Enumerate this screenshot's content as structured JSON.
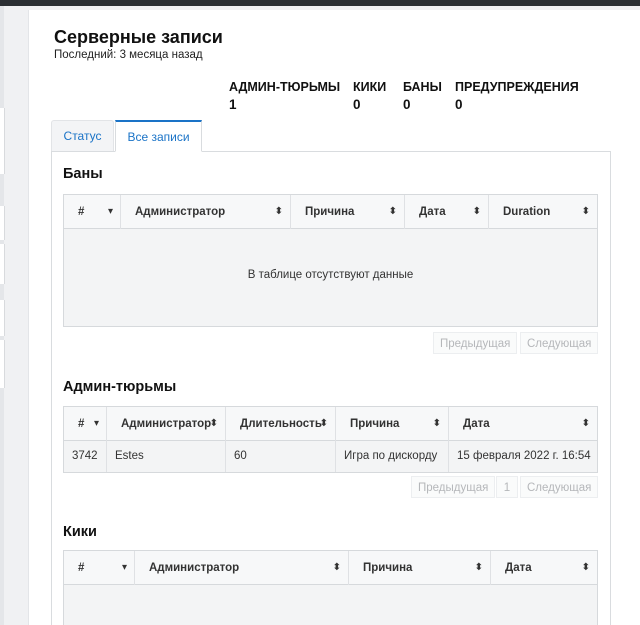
{
  "header": {
    "title": "Серверные записи",
    "last_seen": "Последний: 3 месяца назад"
  },
  "stats": [
    {
      "label": "АДМИН-ТЮРЬМЫ",
      "value": "1"
    },
    {
      "label": "КИКИ",
      "value": "0"
    },
    {
      "label": "БАНЫ",
      "value": "0"
    },
    {
      "label": "ПРЕДУПРЕЖДЕНИЯ",
      "value": "0"
    }
  ],
  "tabs": [
    {
      "label": "Статус",
      "active": false
    },
    {
      "label": "Все записи",
      "active": true
    }
  ],
  "bans": {
    "title": "Баны",
    "columns": [
      "#",
      "Администратор",
      "Причина",
      "Дата",
      "Duration"
    ],
    "empty": "В таблице отсутствуют данные",
    "prev": "Предыдущая",
    "next": "Следующая"
  },
  "jails": {
    "title": "Админ-тюрьмы",
    "columns": [
      "#",
      "Администратор",
      "Длительность",
      "Причина",
      "Дата"
    ],
    "rows": [
      [
        "3742",
        "Estes",
        "60",
        "Игра по дискорду",
        "15 февраля 2022 г. 16:54"
      ]
    ],
    "prev": "Предыдущая",
    "page": "1",
    "next": "Следующая"
  },
  "kicks": {
    "title": "Кики",
    "columns": [
      "#",
      "Администратор",
      "Причина",
      "Дата"
    ]
  },
  "icons": {
    "sort_desc": "▾",
    "sort_both": "⬍"
  }
}
